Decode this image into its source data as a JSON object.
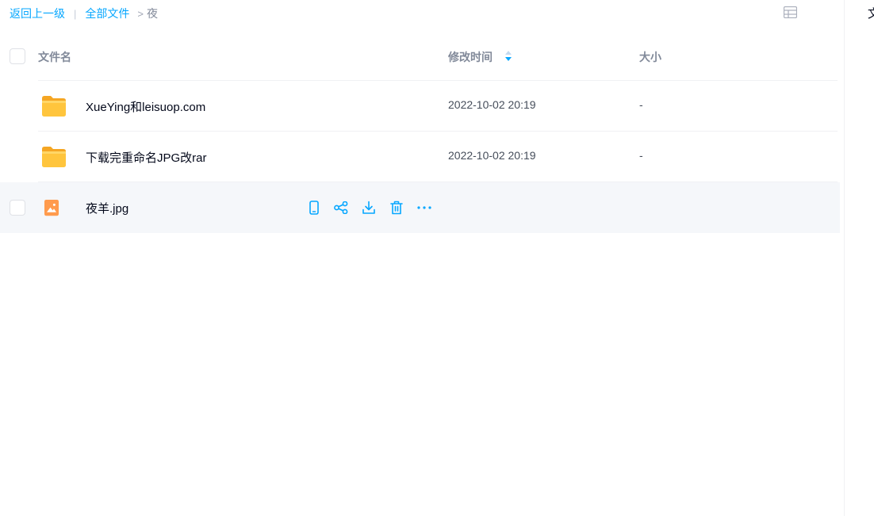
{
  "breadcrumb": {
    "back": "返回上一级",
    "separator": "|",
    "all_files": "全部文件",
    "arrow": ">",
    "current": "夜"
  },
  "header": {
    "name": "文件名",
    "modified": "修改时间",
    "size": "大小"
  },
  "files": [
    {
      "name": "XueYing和leisuop.com",
      "modified": "2022-10-02 20:19",
      "size": "-",
      "icon": "folder-icon"
    },
    {
      "name": "下载完重命名JPG改rar",
      "modified": "2022-10-02 20:19",
      "size": "-",
      "icon": "folder-icon"
    },
    {
      "name": "夜羊.jpg",
      "modified": "",
      "size": "",
      "icon": "image-file-icon"
    }
  ],
  "row_actions": [
    "phone-icon",
    "share-icon",
    "download-icon",
    "trash-icon",
    "more-icon"
  ],
  "right_panel": {
    "peek_text": "文"
  },
  "colors": {
    "accent": "#06a7ff",
    "folder": "#ffc53d",
    "image_file": "#ff9b4d",
    "hover_bg": "#f5f7fa"
  }
}
